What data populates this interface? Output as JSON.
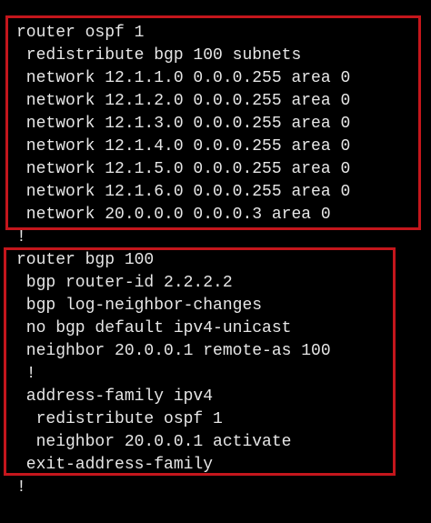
{
  "terminal": {
    "lines": [
      "router ospf 1",
      " redistribute bgp 100 subnets",
      " network 12.1.1.0 0.0.0.255 area 0",
      " network 12.1.2.0 0.0.0.255 area 0",
      " network 12.1.3.0 0.0.0.255 area 0",
      " network 12.1.4.0 0.0.0.255 area 0",
      " network 12.1.5.0 0.0.0.255 area 0",
      " network 12.1.6.0 0.0.0.255 area 0",
      " network 20.0.0.0 0.0.0.3 area 0",
      "!",
      "router bgp 100",
      " bgp router-id 2.2.2.2",
      " bgp log-neighbor-changes",
      " no bgp default ipv4-unicast",
      " neighbor 20.0.0.1 remote-as 100",
      " !",
      " address-family ipv4",
      "  redistribute ospf 1",
      "  neighbor 20.0.0.1 activate",
      " exit-address-family",
      "!"
    ]
  },
  "colors": {
    "background": "#000000",
    "text": "#e6e6e6",
    "highlight_border": "#c4161c"
  }
}
